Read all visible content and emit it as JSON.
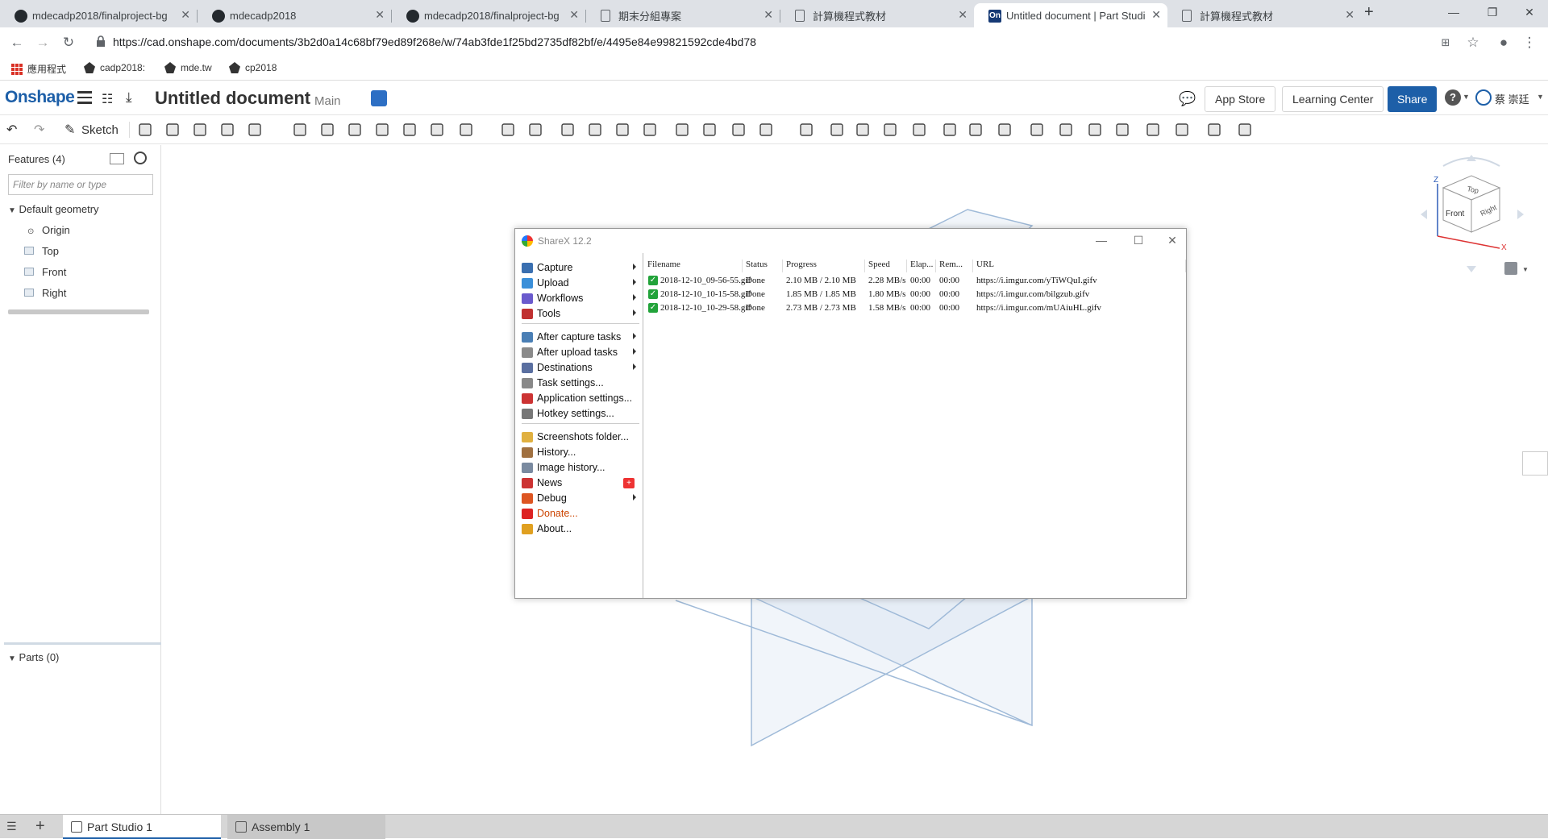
{
  "browser": {
    "tabs": [
      {
        "title": "mdecadp2018/finalproject-bg",
        "icon": "github-icon"
      },
      {
        "title": "mdecadp2018",
        "icon": "github-icon"
      },
      {
        "title": "mdecadp2018/finalproject-bg",
        "icon": "github-icon"
      },
      {
        "title": "期末分組專案",
        "icon": "document-icon"
      },
      {
        "title": "計算機程式教材",
        "icon": "document-icon"
      },
      {
        "title": "Untitled document | Part Studi",
        "icon": "onshape-icon",
        "active": true
      },
      {
        "title": "計算機程式教材",
        "icon": "document-icon"
      }
    ],
    "url": "https://cad.onshape.com/documents/3b2d0a14c68bf79ed89f268e/w/74ab3fde1f25bd2735df82bf/e/4495e84e99821592cde4bd78",
    "bookmarks": [
      "應用程式",
      "cadp2018:",
      "mde.tw",
      "cp2018"
    ]
  },
  "onshape": {
    "logo": "Onshape",
    "doc_title": "Untitled document",
    "branch": "Main",
    "buttons": {
      "app_store": "App Store",
      "learning_center": "Learning Center",
      "share": "Share"
    },
    "user_name": "蔡 崇廷",
    "sketch_label": "Sketch",
    "features_header": "Features (4)",
    "filter_placeholder": "Filter by name or type",
    "tree": {
      "group": "Default geometry",
      "items": [
        "Origin",
        "Top",
        "Front",
        "Right"
      ]
    },
    "parts_header": "Parts (0)",
    "bottom_tabs": [
      "Part Studio 1",
      "Assembly 1"
    ],
    "viewcube": {
      "top": "Top",
      "front": "Front",
      "right": "Right",
      "z": "Z",
      "x": "X"
    }
  },
  "sharex": {
    "title": "ShareX 12.2",
    "menu": [
      {
        "label": "Capture",
        "arrow": true,
        "color": "#3a6fb0"
      },
      {
        "label": "Upload",
        "arrow": true,
        "color": "#3a8fd9"
      },
      {
        "label": "Workflows",
        "arrow": true,
        "color": "#6a5acd"
      },
      {
        "label": "Tools",
        "arrow": true,
        "color": "#c03030"
      },
      {
        "label": "After capture tasks",
        "arrow": true,
        "color": "#4a7fb5"
      },
      {
        "label": "After upload tasks",
        "arrow": true,
        "color": "#8a8a8a"
      },
      {
        "label": "Destinations",
        "arrow": true,
        "color": "#5a6fa0"
      },
      {
        "label": "Task settings...",
        "arrow": false,
        "color": "#888888"
      },
      {
        "label": "Application settings...",
        "arrow": false,
        "color": "#cc3333"
      },
      {
        "label": "Hotkey settings...",
        "arrow": false,
        "color": "#777777"
      },
      {
        "label": "Screenshots folder...",
        "arrow": false,
        "color": "#e0b040"
      },
      {
        "label": "History...",
        "arrow": false,
        "color": "#a07040"
      },
      {
        "label": "Image history...",
        "arrow": false,
        "color": "#7a8aa0"
      },
      {
        "label": "News",
        "arrow": false,
        "color": "#cc3333",
        "badge": "+"
      },
      {
        "label": "Debug",
        "arrow": true,
        "color": "#dd5522"
      },
      {
        "label": "Donate...",
        "arrow": false,
        "color": "#dd2222",
        "accent": "#cc4400"
      },
      {
        "label": "About...",
        "arrow": false,
        "color": "#e0a020"
      }
    ],
    "columns": [
      "Filename",
      "Status",
      "Progress",
      "Speed",
      "Elap...",
      "Rem...",
      "URL"
    ],
    "rows": [
      [
        "2018-12-10_09-56-55.gif",
        "Done",
        "2.10 MB / 2.10 MB",
        "2.28 MB/s",
        "00:00",
        "00:00",
        "https://i.imgur.com/yTiWQuI.gifv"
      ],
      [
        "2018-12-10_10-15-58.gif",
        "Done",
        "1.85 MB / 1.85 MB",
        "1.80 MB/s",
        "00:00",
        "00:00",
        "https://i.imgur.com/bilgzub.gifv"
      ],
      [
        "2018-12-10_10-29-58.gif",
        "Done",
        "2.73 MB / 2.73 MB",
        "1.58 MB/s",
        "00:00",
        "00:00",
        "https://i.imgur.com/mUAiuHL.gifv"
      ]
    ]
  }
}
